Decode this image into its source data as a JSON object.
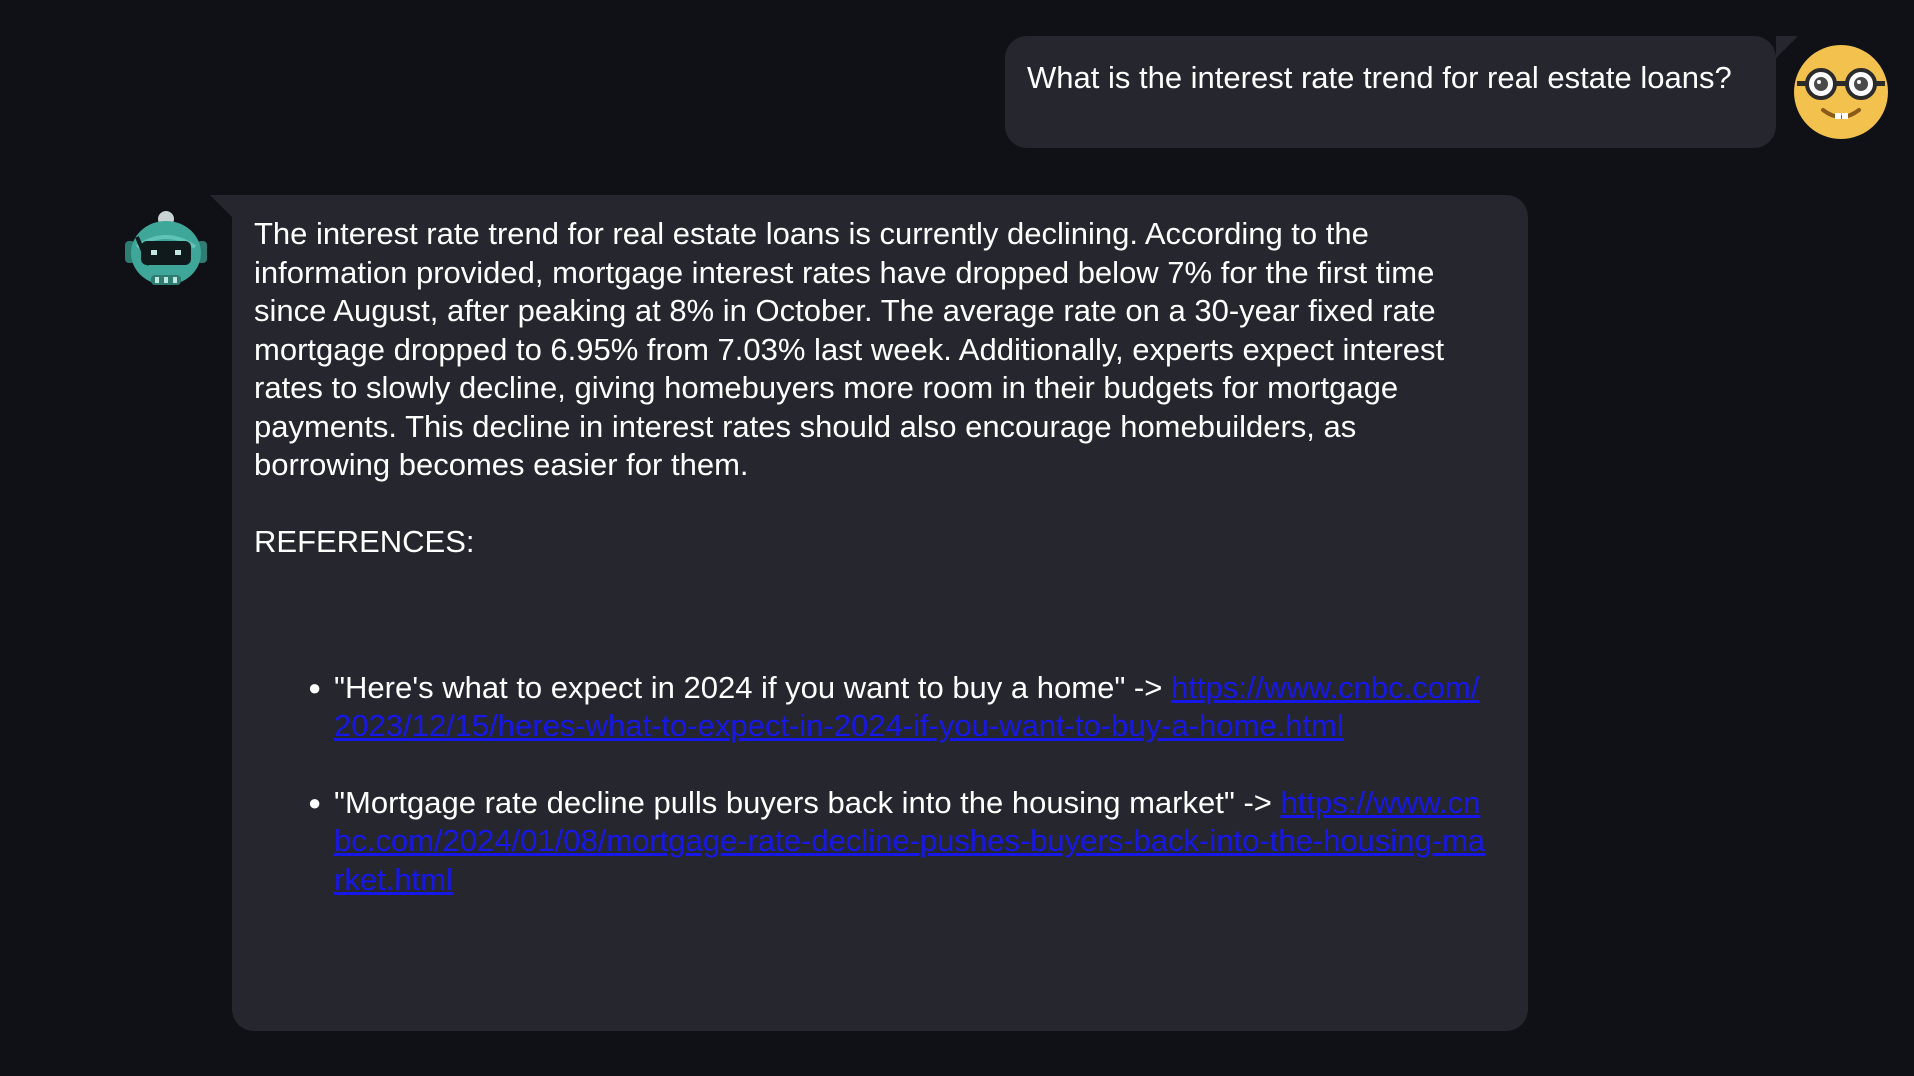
{
  "colors": {
    "page_background": "#101116",
    "bubble_background": "#26272e",
    "text": "#ffffff",
    "link": "#1717e8",
    "user_avatar_face": "#f2c14e",
    "bot_avatar_teal": "#3ea79a"
  },
  "user_message": {
    "avatar_icon": "nerd-face-avatar-icon",
    "text": "What is the interest rate trend for real estate loans?"
  },
  "bot_message": {
    "avatar_icon": "robot-avatar-icon",
    "text": "The interest rate trend for real estate loans is currently declining. According to the information provided, mortgage interest rates have dropped below 7% for the first time since August, after peaking at 8% in October. The average rate on a 30-year fixed rate mortgage dropped to 6.95% from 7.03% last week. Additionally, experts expect interest rates to slowly decline, giving homebuyers more room in their budgets for mortgage payments. This decline in interest rates should also encourage homebuilders, as borrowing becomes easier for them.",
    "references_heading": "REFERENCES:",
    "references": [
      {
        "title": "\"Here's what to expect in 2024 if you want to buy a home\" ->",
        "url": "https://www.cnbc.com/2023/12/15/heres-what-to-expect-in-2024-if-you-want-to-buy-a-home.html"
      },
      {
        "title": "\"Mortgage rate decline pulls buyers back into the housing market\" ->",
        "url": "https://www.cnbc.com/2024/01/08/mortgage-rate-decline-pushes-buyers-back-into-the-housing-market.html"
      }
    ]
  }
}
